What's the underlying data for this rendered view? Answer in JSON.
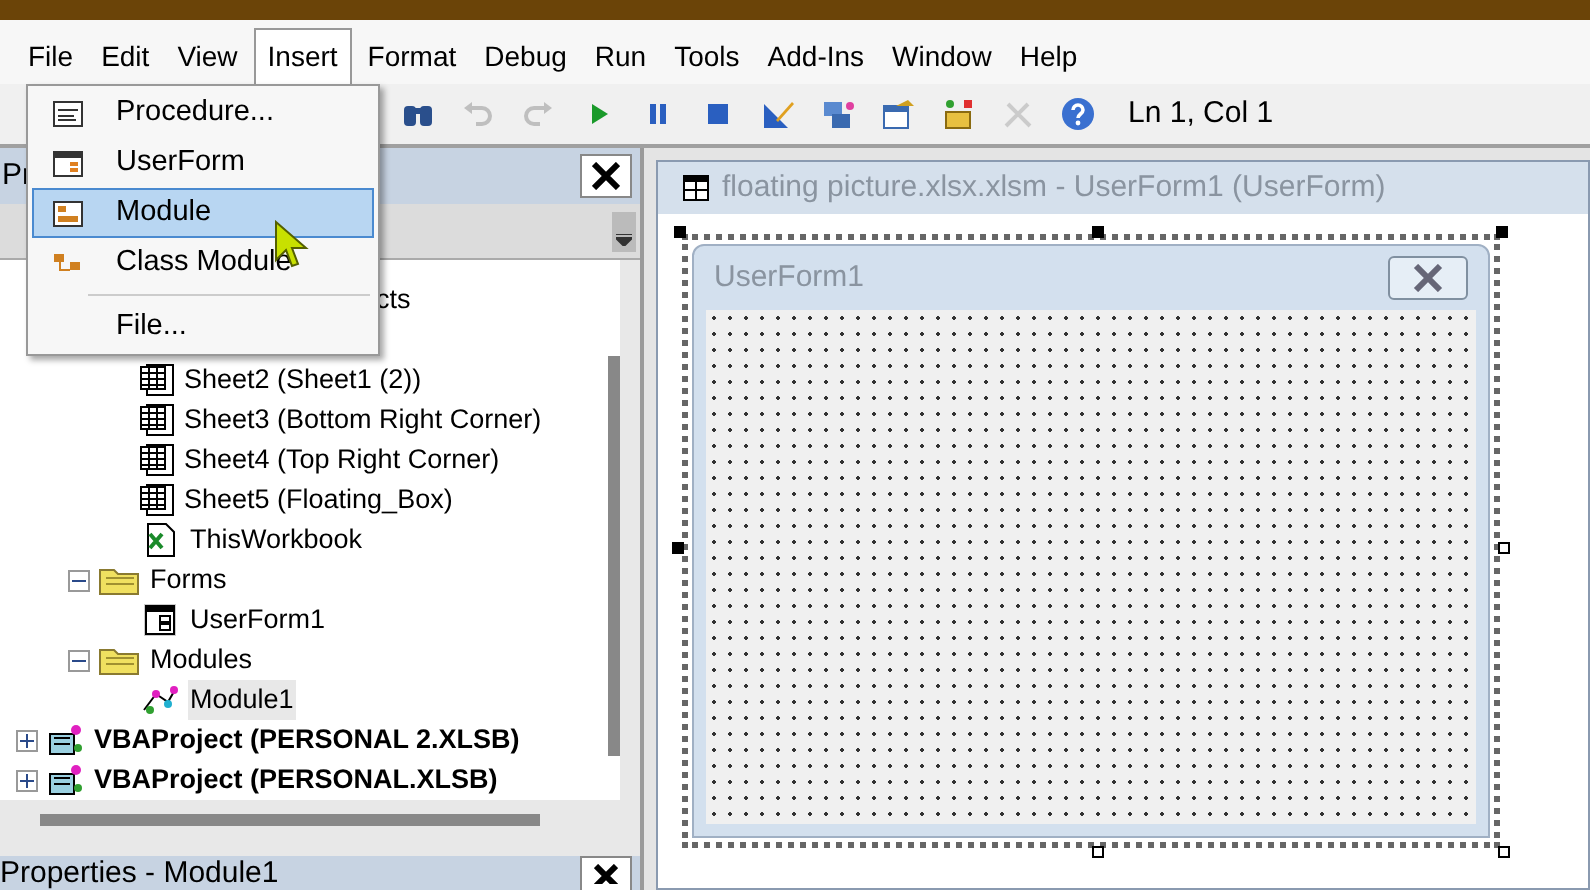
{
  "menu_bar": [
    {
      "label": "File",
      "selected": false
    },
    {
      "label": "Edit",
      "selected": false
    },
    {
      "label": "View",
      "selected": false
    },
    {
      "label": "Insert",
      "selected": true
    },
    {
      "label": "Format",
      "selected": false
    },
    {
      "label": "Debug",
      "selected": false
    },
    {
      "label": "Run",
      "selected": false
    },
    {
      "label": "Tools",
      "selected": false
    },
    {
      "label": "Add-Ins",
      "selected": false
    },
    {
      "label": "Window",
      "selected": false
    },
    {
      "label": "Help",
      "selected": false
    }
  ],
  "insert_menu": [
    {
      "label": "Procedure...",
      "kind": "procedure",
      "selected": false
    },
    {
      "label": "UserForm",
      "kind": "userform",
      "selected": false
    },
    {
      "label": "Module",
      "kind": "module",
      "selected": true
    },
    {
      "label": "Class Module",
      "kind": "class",
      "selected": false
    },
    {
      "label": "File...",
      "kind": "file",
      "selected": false
    }
  ],
  "toolbar": {
    "tools": [
      {
        "kind": "find",
        "disabled": false
      },
      {
        "kind": "undo",
        "disabled": true
      },
      {
        "kind": "redo",
        "disabled": true
      },
      {
        "kind": "run",
        "disabled": false
      },
      {
        "kind": "pause",
        "disabled": false
      },
      {
        "kind": "stop",
        "disabled": false
      },
      {
        "kind": "design",
        "disabled": false
      },
      {
        "kind": "explorer",
        "disabled": false
      },
      {
        "kind": "properties",
        "disabled": false
      },
      {
        "kind": "browser",
        "disabled": false
      },
      {
        "kind": "toolbox",
        "disabled": true
      },
      {
        "kind": "help",
        "disabled": false
      }
    ],
    "position": "Ln 1, Col 1"
  },
  "project_panel": {
    "title": "Pr",
    "tree": [
      {
        "label": "cts",
        "kind": "folder_hidden",
        "children": [
          {
            "label": "Sheet2 (Sheet1 (2))",
            "kind": "sheet",
            "selected": false
          },
          {
            "label": "Sheet3 (Bottom Right Corner)",
            "kind": "sheet",
            "selected": false
          },
          {
            "label": "Sheet4 (Top Right Corner)",
            "kind": "sheet",
            "selected": false
          },
          {
            "label": "Sheet5 (Floating_Box)",
            "kind": "sheet",
            "selected": false
          },
          {
            "label": "ThisWorkbook",
            "kind": "workbook",
            "selected": false
          }
        ]
      },
      {
        "label": "Forms",
        "kind": "folder",
        "expanded": true,
        "children": [
          {
            "label": "UserForm1",
            "kind": "form",
            "selected": false
          }
        ]
      },
      {
        "label": "Modules",
        "kind": "folder",
        "expanded": true,
        "children": [
          {
            "label": "Module1",
            "kind": "module",
            "selected": true
          }
        ]
      }
    ],
    "projects": [
      {
        "label": "VBAProject (PERSONAL 2.XLSB)",
        "expanded": false
      },
      {
        "label": "VBAProject (PERSONAL.XLSB)",
        "expanded": false
      }
    ]
  },
  "properties_panel": {
    "title": "Properties - Module1"
  },
  "designer": {
    "title": "floating picture.xlsx.xlsm - UserForm1 (UserForm)",
    "form_caption": "UserForm1"
  }
}
